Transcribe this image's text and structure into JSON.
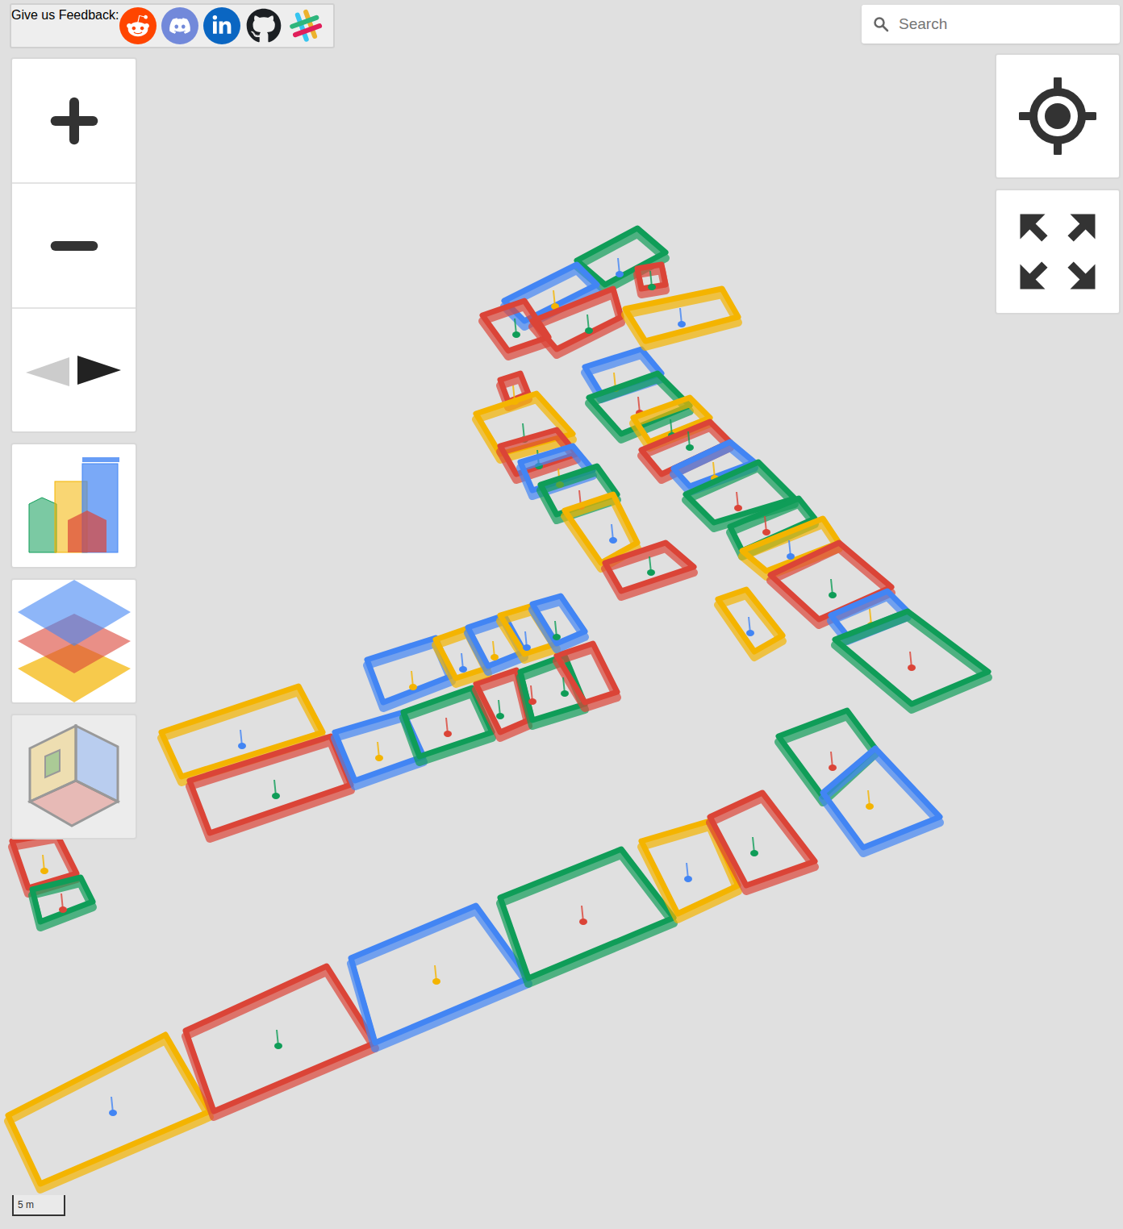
{
  "feedback": {
    "label": "Give us Feedback:",
    "links": [
      {
        "kind": "reddit"
      },
      {
        "kind": "discord"
      },
      {
        "kind": "linkedin"
      },
      {
        "kind": "github"
      },
      {
        "kind": "slack"
      }
    ]
  },
  "search": {
    "placeholder": "Search"
  },
  "scale_bar": {
    "label": "5 m"
  },
  "view_buttons": [
    {
      "kind": "buildings",
      "active": false
    },
    {
      "kind": "levels",
      "active": false
    },
    {
      "kind": "view3d",
      "active": true
    }
  ],
  "rooms": [
    {
      "color": "#f4b400",
      "pin_color": "#4285f4"
    },
    {
      "color": "#db4437",
      "pin_color": "#0f9d58"
    },
    {
      "color": "#4285f4",
      "pin_color": "#f4b400"
    },
    {
      "color": "#0f9d58",
      "pin_color": "#db4437"
    },
    {
      "color": "#f4b400",
      "pin_color": "#4285f4"
    },
    {
      "color": "#db4437",
      "pin_color": "#0f9d58"
    },
    {
      "color": "#0f9d58",
      "pin_color": "#db4437"
    },
    {
      "color": "#4285f4",
      "pin_color": "#f4b400"
    },
    {
      "color": "#f4b400",
      "pin_color": "#4285f4"
    },
    {
      "color": "#db4437",
      "pin_color": "#0f9d58"
    },
    {
      "color": "#4285f4",
      "pin_color": "#f4b400"
    },
    {
      "color": "#0f9d58",
      "pin_color": "#db4437"
    },
    {
      "color": "#db4437",
      "pin_color": "#0f9d58"
    },
    {
      "color": "#0f9d58",
      "pin_color": "#db4437"
    },
    {
      "color": "#db4437",
      "pin_color": "#0f9d58"
    },
    {
      "color": "#4285f4",
      "pin_color": "#f4b400"
    },
    {
      "color": "#f4b400",
      "pin_color": "#4285f4"
    },
    {
      "color": "#4285f4",
      "pin_color": "#f4b400"
    },
    {
      "color": "#f4b400",
      "pin_color": "#4285f4"
    },
    {
      "color": "#4285f4",
      "pin_color": "#0f9d58"
    },
    {
      "color": "#db4437",
      "pin_color": "#f4b400"
    },
    {
      "color": "#0f9d58",
      "pin_color": "#db4437"
    },
    {
      "color": "#db4437",
      "pin_color": "#f4b400"
    },
    {
      "color": "#f4b400",
      "pin_color": "#0f9d58"
    },
    {
      "color": "#db4437",
      "pin_color": "#0f9d58"
    },
    {
      "color": "#4285f4",
      "pin_color": "#f4b400"
    },
    {
      "color": "#0f9d58",
      "pin_color": "#db4437"
    },
    {
      "color": "#f4b400",
      "pin_color": "#4285f4"
    },
    {
      "color": "#db4437",
      "pin_color": "#0f9d58"
    },
    {
      "color": "#f4b400",
      "pin_color": "#4285f4"
    },
    {
      "color": "#4285f4",
      "pin_color": "#f4b400"
    },
    {
      "color": "#0f9d58",
      "pin_color": "#db4437"
    },
    {
      "color": "#f4b400",
      "pin_color": "#0f9d58"
    },
    {
      "color": "#db4437",
      "pin_color": "#0f9d58"
    },
    {
      "color": "#4285f4",
      "pin_color": "#f4b400"
    },
    {
      "color": "#0f9d58",
      "pin_color": "#db4437"
    },
    {
      "color": "#0f9d58",
      "pin_color": "#db4437"
    },
    {
      "color": "#f4b400",
      "pin_color": "#4285f4"
    },
    {
      "color": "#db4437",
      "pin_color": "#0f9d58"
    },
    {
      "color": "#4285f4",
      "pin_color": "#f4b400"
    },
    {
      "color": "#0f9d58",
      "pin_color": "#db4437"
    },
    {
      "color": "#0f9d58",
      "pin_color": "#4285f4"
    },
    {
      "color": "#4285f4",
      "pin_color": "#f4b400"
    },
    {
      "color": "#db4437",
      "pin_color": "#0f9d58"
    },
    {
      "color": "#db4437",
      "pin_color": "#0f9d58"
    },
    {
      "color": "#f4b400",
      "pin_color": "#4285f4"
    },
    {
      "color": "#db4437",
      "pin_color": "#0f9d58"
    }
  ]
}
